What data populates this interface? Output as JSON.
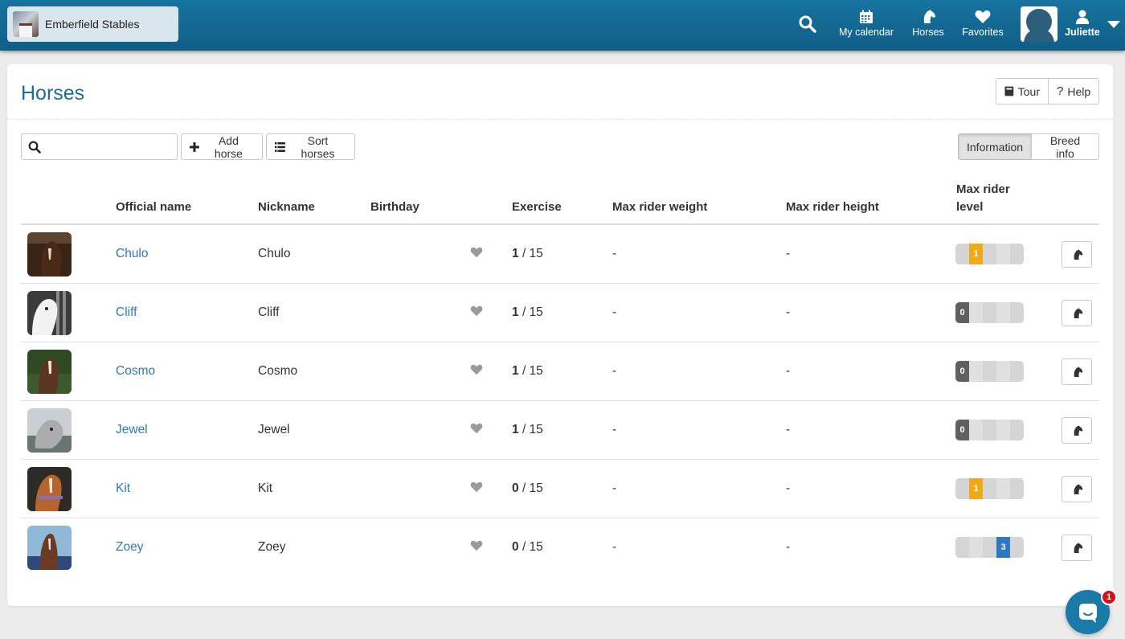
{
  "app": {
    "name": "Emberfield Stables"
  },
  "nav": {
    "search_icon": "search-icon",
    "items": [
      {
        "label": "My calendar",
        "icon": "calendar-icon"
      },
      {
        "label": "Horses",
        "icon": "horse-head-icon"
      },
      {
        "label": "Favorites",
        "icon": "heart-icon"
      },
      {
        "label": "Juliette",
        "icon": "user-icon"
      }
    ]
  },
  "page": {
    "title": "Horses",
    "tour_label": "Tour",
    "help_label": "Help"
  },
  "toolbar": {
    "search_value": "",
    "add_label": "Add horse",
    "sort_label": "Sort horses",
    "info_label": "Information",
    "breed_label": "Breed info"
  },
  "table": {
    "headers": {
      "official": "Official name",
      "nickname": "Nickname",
      "birthday": "Birthday",
      "exercise": "Exercise",
      "weight": "Max rider weight",
      "height": "Max rider height",
      "level_line1": "Max rider",
      "level_line2": "level"
    },
    "rows": [
      {
        "official": "Chulo",
        "nickname": "Chulo",
        "birthday": "",
        "exercise_done": "1",
        "exercise_total": "/ 15",
        "weight": "-",
        "height": "-",
        "level": "1"
      },
      {
        "official": "Cliff",
        "nickname": "Cliff",
        "birthday": "",
        "exercise_done": "1",
        "exercise_total": "/ 15",
        "weight": "-",
        "height": "-",
        "level": "0"
      },
      {
        "official": "Cosmo",
        "nickname": "Cosmo",
        "birthday": "",
        "exercise_done": "1",
        "exercise_total": "/ 15",
        "weight": "-",
        "height": "-",
        "level": "0"
      },
      {
        "official": "Jewel",
        "nickname": "Jewel",
        "birthday": "",
        "exercise_done": "1",
        "exercise_total": "/ 15",
        "weight": "-",
        "height": "-",
        "level": "0"
      },
      {
        "official": "Kit",
        "nickname": "Kit",
        "birthday": "",
        "exercise_done": "0",
        "exercise_total": "/ 15",
        "weight": "-",
        "height": "-",
        "level": "1"
      },
      {
        "official": "Zoey",
        "nickname": "Zoey",
        "birthday": "",
        "exercise_done": "0",
        "exercise_total": "/ 15",
        "weight": "-",
        "height": "-",
        "level": "3"
      }
    ]
  },
  "chat": {
    "badge": "1"
  },
  "colors": {
    "topbar": "#1a74a0",
    "link": "#2f7ab7",
    "level_0": "#606060",
    "level_1": "#f2a916",
    "level_3": "#2f79c2",
    "badge": "#d0131b"
  }
}
